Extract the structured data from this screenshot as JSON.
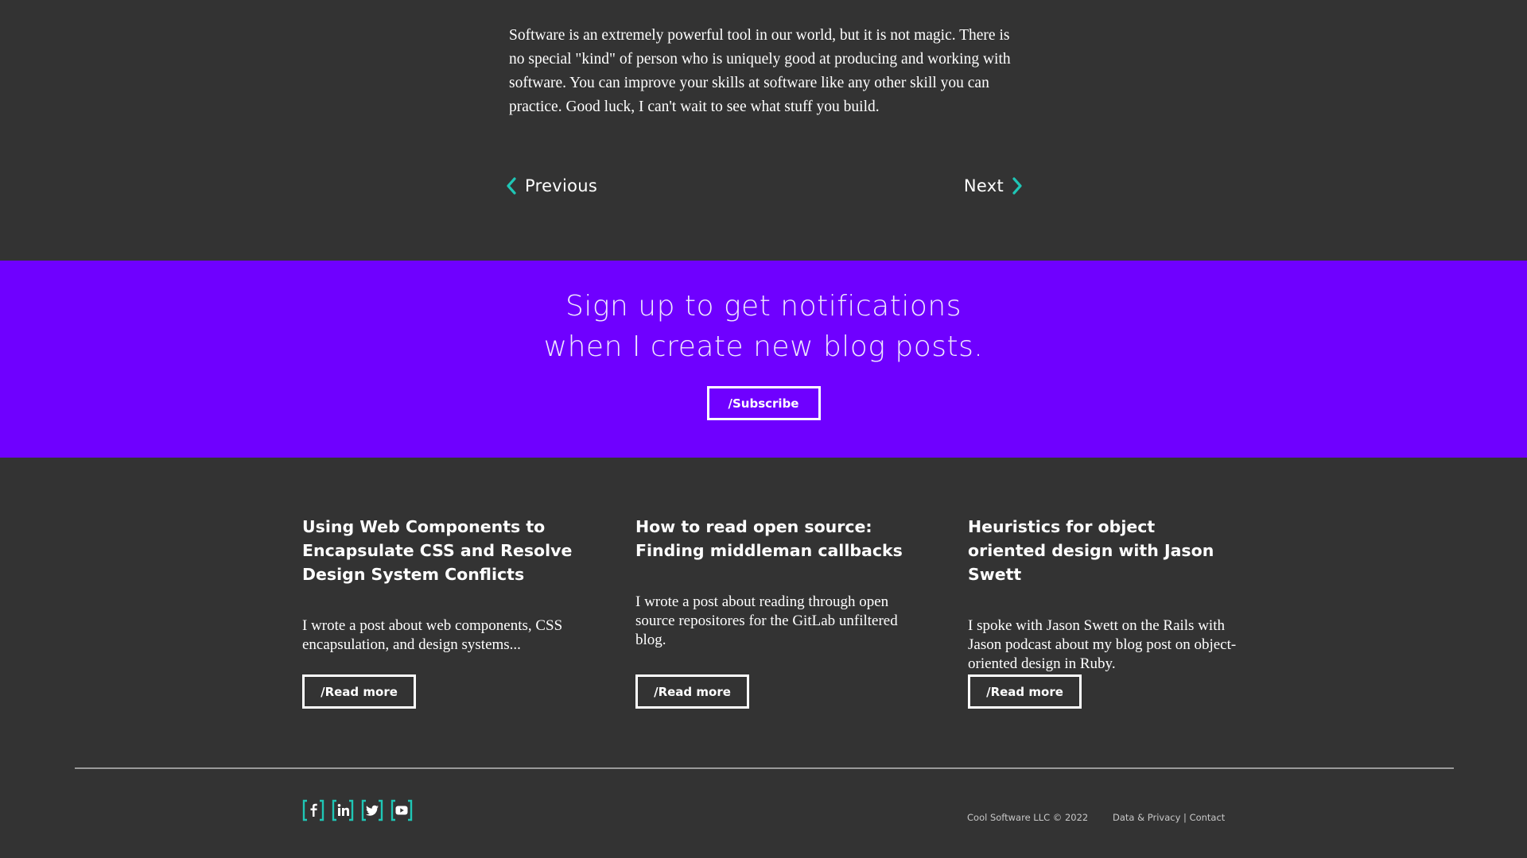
{
  "article": {
    "paragraph": "Software is an extremely powerful tool in our world, but it is not magic. There is no special \"kind\" of person who is uniquely good at producing and working with software. You can improve your skills at software like any other skill you can practice. Good luck, I can't wait to see what stuff you build."
  },
  "pager": {
    "previous_label": "Previous",
    "next_label": "Next"
  },
  "subscribe_band": {
    "title_line1": "Sign up to get notifications",
    "title_line2": "when I create new blog posts.",
    "button_label": "/Subscribe",
    "background": "#6f00ff"
  },
  "cards": [
    {
      "title": "Using Web Components to Encapsulate CSS and Resolve Design System Conflicts",
      "summary": "I wrote a post about web components, CSS encapsulation, and design systems...",
      "button_label": "/Read more"
    },
    {
      "title": "How to read open source: Finding middleman callbacks",
      "summary": "I wrote a post about reading through open source repositores for the GitLab unfiltered blog.",
      "button_label": "/Read more"
    },
    {
      "title": "Heuristics for object oriented design with Jason Swett",
      "summary": "I spoke with Jason Swett on the Rails with Jason podcast about my blog post on object-oriented design in Ruby.",
      "button_label": "/Read more"
    }
  ],
  "footer": {
    "social_icons": [
      "facebook-icon",
      "linkedin-icon",
      "twitter-icon",
      "youtube-icon"
    ],
    "accent_color": "#1fc6b5",
    "copyright": "Cool Software LLC © 2022",
    "data_privacy_link": "Data & Privacy",
    "separator": "|",
    "contact_link": "Contact"
  }
}
